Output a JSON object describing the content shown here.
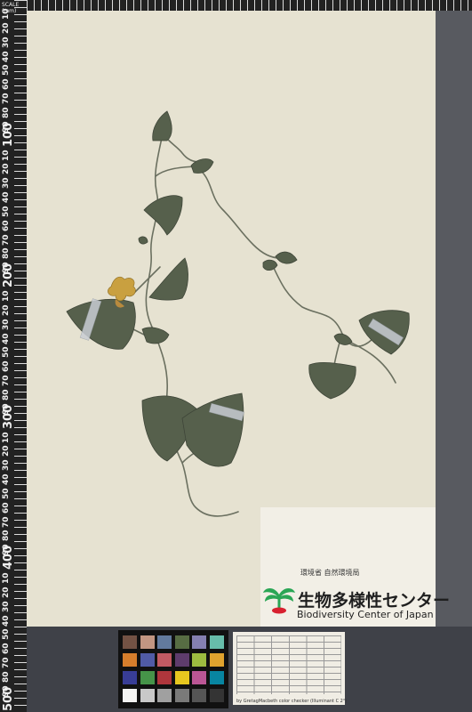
{
  "ruler": {
    "scale_note": "SCALE (mm)",
    "labels": [
      "10",
      "20",
      "30",
      "40",
      "50",
      "60",
      "70",
      "80",
      "90",
      "100",
      "10",
      "20",
      "30",
      "40",
      "50",
      "60",
      "70",
      "80",
      "90",
      "200",
      "10",
      "20",
      "30",
      "40",
      "50",
      "60",
      "70",
      "80",
      "90",
      "300",
      "10",
      "20",
      "30",
      "40",
      "50",
      "60",
      "70",
      "80",
      "90",
      "400",
      "10",
      "20",
      "30",
      "40",
      "50",
      "60",
      "70",
      "80",
      "90",
      "500"
    ]
  },
  "institution": {
    "ministry": "環境省 自然環境局",
    "name_jp": "生物多様性センター",
    "name_en": "Biodiversity Center of Japan"
  },
  "color_checker": {
    "footer": "by GretagMacbeth color checker (Illuminant C 2°)",
    "swatches": [
      "#735244",
      "#c29682",
      "#627a9d",
      "#576c43",
      "#8580b1",
      "#67bdaa",
      "#d67e2c",
      "#505ba6",
      "#c15a63",
      "#5e3c6c",
      "#9dbc40",
      "#e0a32e",
      "#383d96",
      "#469449",
      "#af363c",
      "#e7c71f",
      "#bb5695",
      "#0885a1",
      "#f3f3f2",
      "#c8c8c8",
      "#a0a0a0",
      "#7a7a79",
      "#555555",
      "#343434"
    ]
  },
  "colors": {
    "paper": "#e6e2d1",
    "leaf": "#56604c",
    "stem": "#6b7060",
    "flower": "#c9a040",
    "logo_green": "#2aa655",
    "logo_red": "#d8202f"
  }
}
